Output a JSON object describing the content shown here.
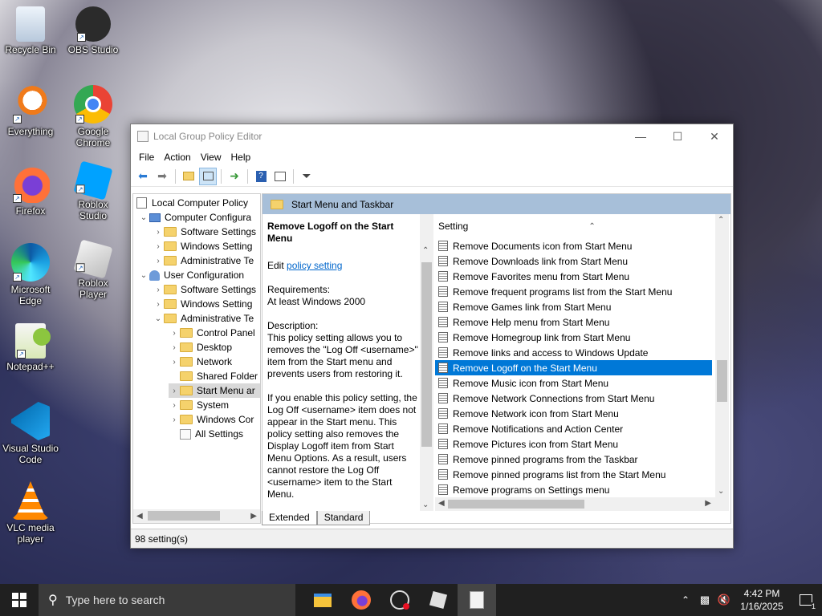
{
  "desktop": {
    "icons": [
      {
        "label": "Recycle Bin"
      },
      {
        "label": "OBS Studio"
      },
      {
        "label": "Everything"
      },
      {
        "label": "Google Chrome"
      },
      {
        "label": "Firefox"
      },
      {
        "label": "Roblox Studio"
      },
      {
        "label": "Microsoft Edge"
      },
      {
        "label": "Roblox Player"
      },
      {
        "label": "Notepad++"
      },
      {
        "label": "Visual Studio Code"
      },
      {
        "label": "VLC media player"
      }
    ]
  },
  "window": {
    "title": "Local Group Policy Editor",
    "menu": [
      "File",
      "Action",
      "View",
      "Help"
    ],
    "tree": [
      {
        "label": "Local Computer Policy"
      },
      {
        "label": "Computer Configura"
      },
      {
        "label": "Software Settings"
      },
      {
        "label": "Windows Setting"
      },
      {
        "label": "Administrative Te"
      },
      {
        "label": "User Configuration"
      },
      {
        "label": "Software Settings"
      },
      {
        "label": "Windows Setting"
      },
      {
        "label": "Administrative Te"
      },
      {
        "label": "Control Panel"
      },
      {
        "label": "Desktop"
      },
      {
        "label": "Network"
      },
      {
        "label": "Shared Folder"
      },
      {
        "label": "Start Menu ar"
      },
      {
        "label": "System"
      },
      {
        "label": "Windows Cor"
      },
      {
        "label": "All Settings"
      }
    ],
    "pane_header": "Start Menu and Taskbar",
    "description": {
      "title": "Remove Logoff on the Start Menu",
      "edit_prefix": "Edit ",
      "edit_link": "policy setting",
      "requirements_label": "Requirements:",
      "requirements_value": "At least Windows 2000",
      "description_label": "Description:",
      "description_text": "This policy setting allows you to removes the \"Log Off <username>\" item from the Start menu and prevents users from restoring it.",
      "description_more": "If you enable this policy setting, the Log Off <username> item does not appear in the Start menu. This policy setting also removes the Display Logoff item from Start Menu Options. As a result, users cannot restore the Log Off <username> item to the Start Menu."
    },
    "list_header": "Setting",
    "settings": [
      "Remove Documents icon from Start Menu",
      "Remove Downloads link from Start Menu",
      "Remove Favorites menu from Start Menu",
      "Remove frequent programs list from the Start Menu",
      "Remove Games link from Start Menu",
      "Remove Help menu from Start Menu",
      "Remove Homegroup link from Start Menu",
      "Remove links and access to Windows Update",
      "Remove Logoff on the Start Menu",
      "Remove Music icon from Start Menu",
      "Remove Network Connections from Start Menu",
      "Remove Network icon from Start Menu",
      "Remove Notifications and Action Center",
      "Remove Pictures icon from Start Menu",
      "Remove pinned programs from the Taskbar",
      "Remove pinned programs list from the Start Menu",
      "Remove programs on Settings menu"
    ],
    "selected_setting_index": 8,
    "tabs": [
      "Extended",
      "Standard"
    ],
    "status": "98 setting(s)"
  },
  "taskbar": {
    "search_placeholder": "Type here to search",
    "time": "4:42 PM",
    "date": "1/16/2025",
    "notification_count": "1"
  }
}
